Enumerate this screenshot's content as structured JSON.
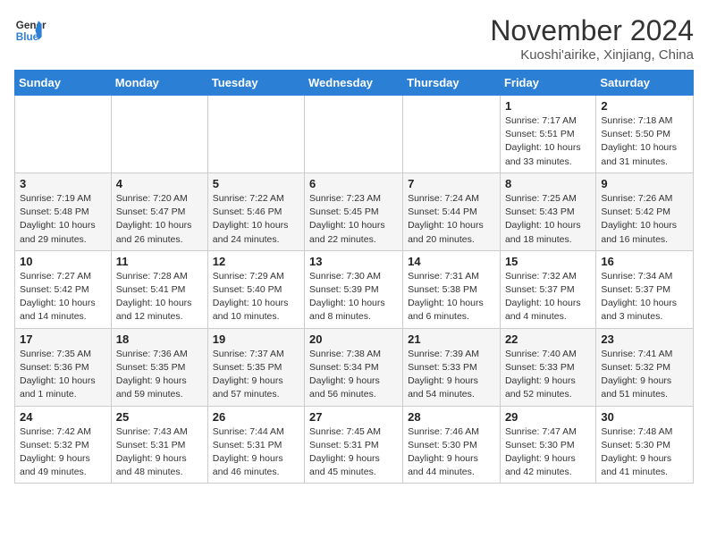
{
  "logo": {
    "line1": "General",
    "line2": "Blue"
  },
  "title": "November 2024",
  "subtitle": "Kuoshi'airike, Xinjiang, China",
  "days_of_week": [
    "Sunday",
    "Monday",
    "Tuesday",
    "Wednesday",
    "Thursday",
    "Friday",
    "Saturday"
  ],
  "weeks": [
    [
      {
        "day": "",
        "info": ""
      },
      {
        "day": "",
        "info": ""
      },
      {
        "day": "",
        "info": ""
      },
      {
        "day": "",
        "info": ""
      },
      {
        "day": "",
        "info": ""
      },
      {
        "day": "1",
        "info": "Sunrise: 7:17 AM\nSunset: 5:51 PM\nDaylight: 10 hours and 33 minutes."
      },
      {
        "day": "2",
        "info": "Sunrise: 7:18 AM\nSunset: 5:50 PM\nDaylight: 10 hours and 31 minutes."
      }
    ],
    [
      {
        "day": "3",
        "info": "Sunrise: 7:19 AM\nSunset: 5:48 PM\nDaylight: 10 hours and 29 minutes."
      },
      {
        "day": "4",
        "info": "Sunrise: 7:20 AM\nSunset: 5:47 PM\nDaylight: 10 hours and 26 minutes."
      },
      {
        "day": "5",
        "info": "Sunrise: 7:22 AM\nSunset: 5:46 PM\nDaylight: 10 hours and 24 minutes."
      },
      {
        "day": "6",
        "info": "Sunrise: 7:23 AM\nSunset: 5:45 PM\nDaylight: 10 hours and 22 minutes."
      },
      {
        "day": "7",
        "info": "Sunrise: 7:24 AM\nSunset: 5:44 PM\nDaylight: 10 hours and 20 minutes."
      },
      {
        "day": "8",
        "info": "Sunrise: 7:25 AM\nSunset: 5:43 PM\nDaylight: 10 hours and 18 minutes."
      },
      {
        "day": "9",
        "info": "Sunrise: 7:26 AM\nSunset: 5:42 PM\nDaylight: 10 hours and 16 minutes."
      }
    ],
    [
      {
        "day": "10",
        "info": "Sunrise: 7:27 AM\nSunset: 5:42 PM\nDaylight: 10 hours and 14 minutes."
      },
      {
        "day": "11",
        "info": "Sunrise: 7:28 AM\nSunset: 5:41 PM\nDaylight: 10 hours and 12 minutes."
      },
      {
        "day": "12",
        "info": "Sunrise: 7:29 AM\nSunset: 5:40 PM\nDaylight: 10 hours and 10 minutes."
      },
      {
        "day": "13",
        "info": "Sunrise: 7:30 AM\nSunset: 5:39 PM\nDaylight: 10 hours and 8 minutes."
      },
      {
        "day": "14",
        "info": "Sunrise: 7:31 AM\nSunset: 5:38 PM\nDaylight: 10 hours and 6 minutes."
      },
      {
        "day": "15",
        "info": "Sunrise: 7:32 AM\nSunset: 5:37 PM\nDaylight: 10 hours and 4 minutes."
      },
      {
        "day": "16",
        "info": "Sunrise: 7:34 AM\nSunset: 5:37 PM\nDaylight: 10 hours and 3 minutes."
      }
    ],
    [
      {
        "day": "17",
        "info": "Sunrise: 7:35 AM\nSunset: 5:36 PM\nDaylight: 10 hours and 1 minute."
      },
      {
        "day": "18",
        "info": "Sunrise: 7:36 AM\nSunset: 5:35 PM\nDaylight: 9 hours and 59 minutes."
      },
      {
        "day": "19",
        "info": "Sunrise: 7:37 AM\nSunset: 5:35 PM\nDaylight: 9 hours and 57 minutes."
      },
      {
        "day": "20",
        "info": "Sunrise: 7:38 AM\nSunset: 5:34 PM\nDaylight: 9 hours and 56 minutes."
      },
      {
        "day": "21",
        "info": "Sunrise: 7:39 AM\nSunset: 5:33 PM\nDaylight: 9 hours and 54 minutes."
      },
      {
        "day": "22",
        "info": "Sunrise: 7:40 AM\nSunset: 5:33 PM\nDaylight: 9 hours and 52 minutes."
      },
      {
        "day": "23",
        "info": "Sunrise: 7:41 AM\nSunset: 5:32 PM\nDaylight: 9 hours and 51 minutes."
      }
    ],
    [
      {
        "day": "24",
        "info": "Sunrise: 7:42 AM\nSunset: 5:32 PM\nDaylight: 9 hours and 49 minutes."
      },
      {
        "day": "25",
        "info": "Sunrise: 7:43 AM\nSunset: 5:31 PM\nDaylight: 9 hours and 48 minutes."
      },
      {
        "day": "26",
        "info": "Sunrise: 7:44 AM\nSunset: 5:31 PM\nDaylight: 9 hours and 46 minutes."
      },
      {
        "day": "27",
        "info": "Sunrise: 7:45 AM\nSunset: 5:31 PM\nDaylight: 9 hours and 45 minutes."
      },
      {
        "day": "28",
        "info": "Sunrise: 7:46 AM\nSunset: 5:30 PM\nDaylight: 9 hours and 44 minutes."
      },
      {
        "day": "29",
        "info": "Sunrise: 7:47 AM\nSunset: 5:30 PM\nDaylight: 9 hours and 42 minutes."
      },
      {
        "day": "30",
        "info": "Sunrise: 7:48 AM\nSunset: 5:30 PM\nDaylight: 9 hours and 41 minutes."
      }
    ]
  ]
}
